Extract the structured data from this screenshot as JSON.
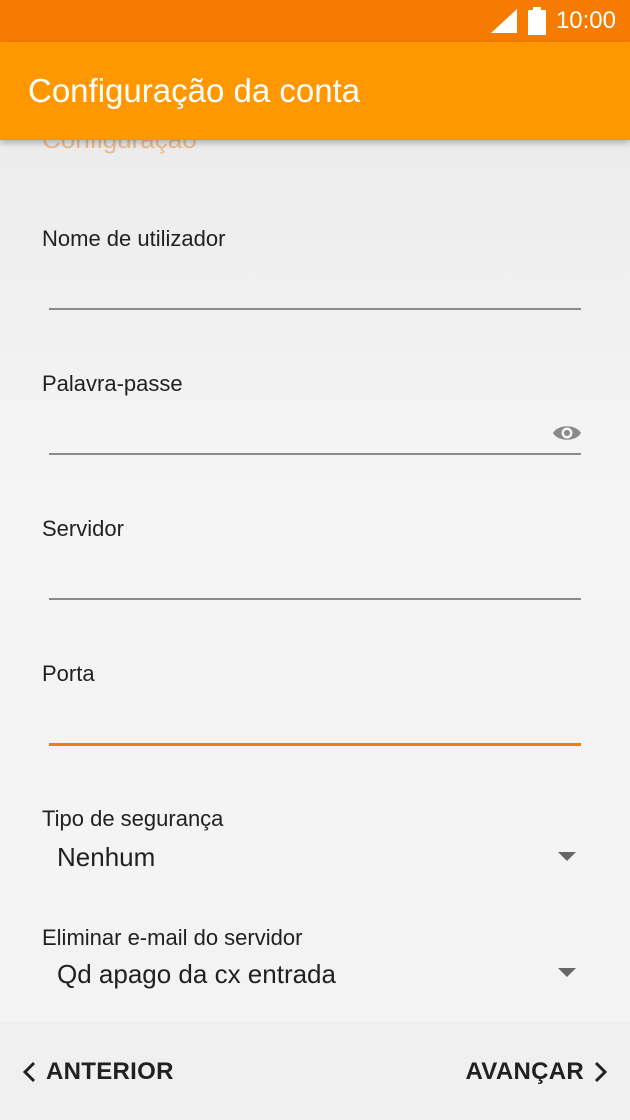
{
  "status_bar": {
    "time": "10:00",
    "icons": [
      "signal-icon",
      "battery-icon"
    ]
  },
  "app_bar": {
    "title": "Configuração da conta"
  },
  "form": {
    "clipped_heading": "Configuração",
    "fields": [
      {
        "label": "Nome de utilizador",
        "value": ""
      },
      {
        "label": "Palavra-passe",
        "value": "",
        "icon": "eye-icon"
      },
      {
        "label": "Servidor",
        "value": ""
      },
      {
        "label": "Porta",
        "value": "",
        "focused": true
      }
    ],
    "security_type": {
      "label": "Tipo de segurança",
      "value": "Nenhum"
    },
    "delete_email": {
      "label": "Eliminar e-mail do servidor",
      "value": "Qd apago da cx entrada"
    }
  },
  "navigation": {
    "previous_label": "ANTERIOR",
    "next_label": "AVANÇAR"
  },
  "colors": {
    "status_bar": "#f57c00",
    "app_bar": "#ff9800",
    "accent": "#f57c00"
  }
}
